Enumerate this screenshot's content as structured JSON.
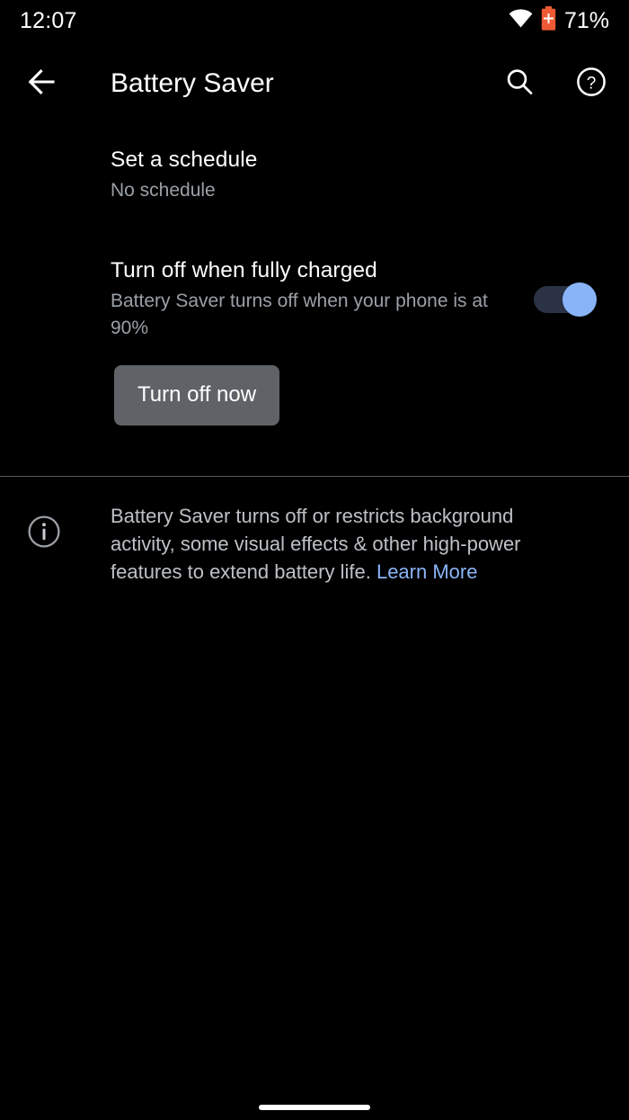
{
  "status_bar": {
    "clock": "12:07",
    "wifi_icon": "wifi-icon",
    "battery_icon": "battery-saver-icon",
    "battery_percent": "71%",
    "battery_icon_color": "#ef5a34"
  },
  "app_bar": {
    "back_icon": "back-arrow-icon",
    "title": "Battery Saver",
    "search_icon": "search-icon",
    "help_icon": "help-circle-icon"
  },
  "preferences": [
    {
      "title": "Set a schedule",
      "summary": "No schedule"
    },
    {
      "title": "Turn off when fully charged",
      "summary": "Battery Saver turns off when your phone is at 90%",
      "toggle_state": "on",
      "toggle_track_color": "#2b3245",
      "toggle_thumb_color": "#8ab4f8"
    }
  ],
  "action_button": {
    "label": "Turn off now",
    "background_color": "#5f6368"
  },
  "footer": {
    "info_icon": "info-circle-icon",
    "text": "Battery Saver turns off or restricts background activity, some visual effects & other high-power features to extend battery life. ",
    "link_label": "Learn More",
    "link_color": "#8ab4f8"
  },
  "nav_bar": {
    "home_indicator": "home-indicator"
  }
}
